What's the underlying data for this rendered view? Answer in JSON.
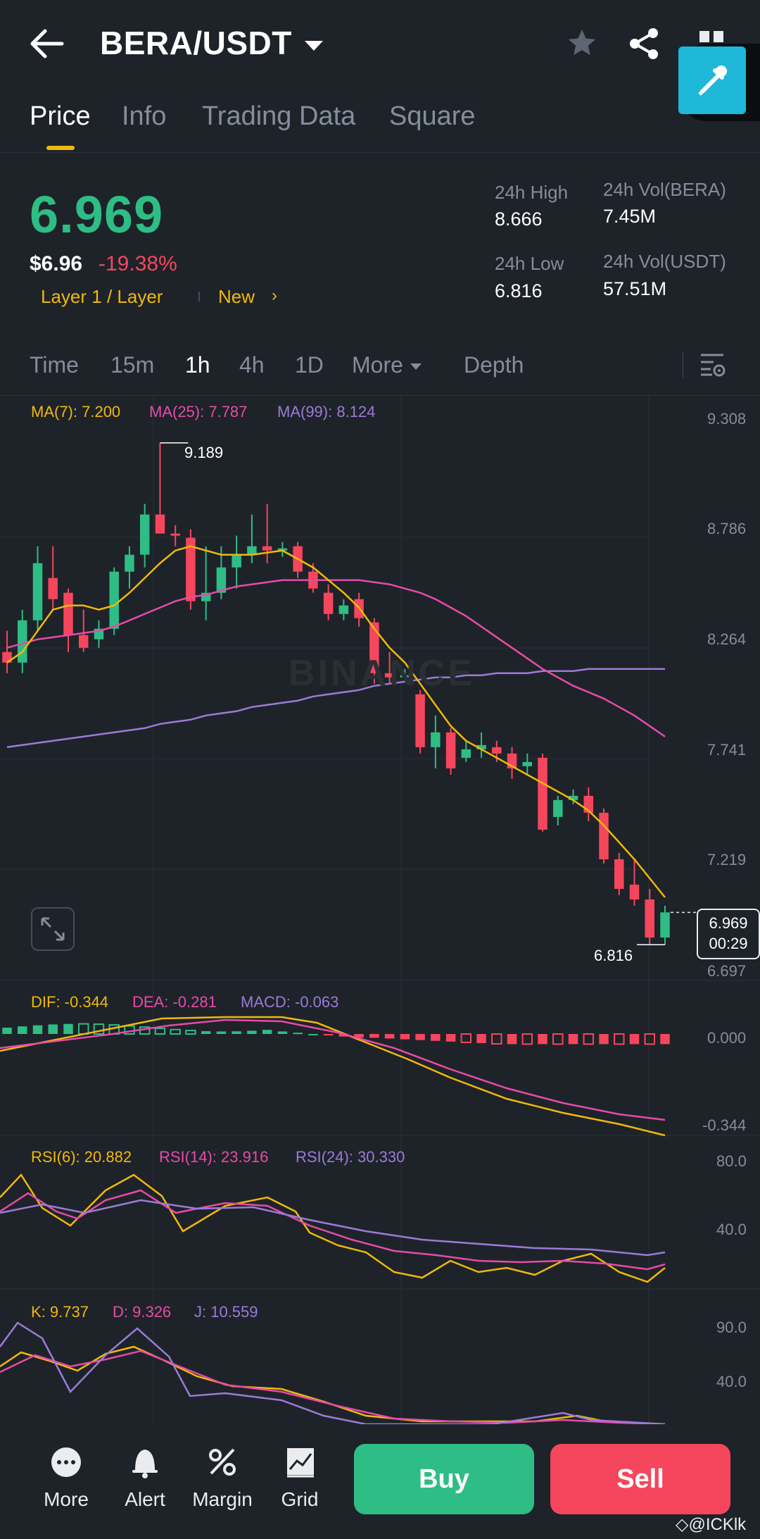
{
  "header": {
    "pair": "BERA/USDT"
  },
  "tabs": [
    "Price",
    "Info",
    "Trading Data",
    "Square"
  ],
  "price": {
    "last": "6.969",
    "usd": "$6.96",
    "change_pct": "-19.38%",
    "tag_category": "Layer 1 / Layer",
    "tag_new": "New",
    "high_label": "24h High",
    "high_value": "8.666",
    "low_label": "24h Low",
    "low_value": "6.816",
    "vol_base_label": "24h Vol(BERA)",
    "vol_base_value": "7.45M",
    "vol_quote_label": "24h Vol(USDT)",
    "vol_quote_value": "57.51M"
  },
  "timeframes": [
    "Time",
    "15m",
    "1h",
    "4h",
    "1D",
    "More",
    "Depth"
  ],
  "active_timeframe": "1h",
  "main_chart": {
    "legend": {
      "ma7": "MA(7): 7.200",
      "ma25": "MA(25): 7.787",
      "ma99": "MA(99): 8.124"
    },
    "price_ticks": [
      "9.308",
      "8.786",
      "8.264",
      "7.741",
      "7.219",
      "6.697"
    ],
    "high_marker": "9.189",
    "low_marker": "6.816",
    "current_price": "6.969",
    "countdown": "00:29",
    "watermark": "BINANCE"
  },
  "macd": {
    "dif": "DIF: -0.344",
    "dea": "DEA: -0.281",
    "macd": "MACD: -0.063",
    "ticks": [
      "0.000",
      "-0.344"
    ]
  },
  "rsi": {
    "rsi6": "RSI(6): 20.882",
    "rsi14": "RSI(14): 23.916",
    "rsi24": "RSI(24): 30.330",
    "ticks": [
      "80.0",
      "40.0"
    ]
  },
  "kdj": {
    "k": "K: 9.737",
    "d": "D: 9.326",
    "j": "J: 10.559",
    "ticks": [
      "90.0",
      "40.0"
    ]
  },
  "bottom_nav": {
    "more": "More",
    "alert": "Alert",
    "margin": "Margin",
    "grid": "Grid",
    "buy": "Buy",
    "sell": "Sell"
  },
  "watermark_user": "@ICKlk",
  "chart_data": {
    "type": "candlestick",
    "interval": "1h",
    "ylim": [
      6.697,
      9.308
    ],
    "candles": [
      [
        8.2,
        8.3,
        8.1,
        8.15
      ],
      [
        8.15,
        8.4,
        8.1,
        8.35
      ],
      [
        8.35,
        8.7,
        8.3,
        8.62
      ],
      [
        8.55,
        8.7,
        8.4,
        8.45
      ],
      [
        8.48,
        8.5,
        8.2,
        8.28
      ],
      [
        8.28,
        8.4,
        8.2,
        8.22
      ],
      [
        8.26,
        8.35,
        8.22,
        8.31
      ],
      [
        8.31,
        8.6,
        8.28,
        8.58
      ],
      [
        8.58,
        8.7,
        8.5,
        8.66
      ],
      [
        8.66,
        8.9,
        8.6,
        8.85
      ],
      [
        8.85,
        9.189,
        8.78,
        8.76
      ],
      [
        8.76,
        8.8,
        8.7,
        8.75
      ],
      [
        8.74,
        8.78,
        8.4,
        8.44
      ],
      [
        8.44,
        8.7,
        8.35,
        8.48
      ],
      [
        8.48,
        8.7,
        8.45,
        8.6
      ],
      [
        8.6,
        8.75,
        8.5,
        8.66
      ],
      [
        8.66,
        8.85,
        8.62,
        8.7
      ],
      [
        8.7,
        8.9,
        8.62,
        8.68
      ],
      [
        8.68,
        8.72,
        8.65,
        8.69
      ],
      [
        8.7,
        8.72,
        8.55,
        8.58
      ],
      [
        8.58,
        8.62,
        8.48,
        8.5
      ],
      [
        8.48,
        8.52,
        8.35,
        8.38
      ],
      [
        8.38,
        8.45,
        8.35,
        8.42
      ],
      [
        8.45,
        8.48,
        8.32,
        8.36
      ],
      [
        8.34,
        8.36,
        8.05,
        8.1
      ],
      [
        8.1,
        8.2,
        8.05,
        8.08
      ],
      [
        8.08,
        8.12,
        8.06,
        8.09
      ],
      [
        8.0,
        8.02,
        7.72,
        7.75
      ],
      [
        7.75,
        7.9,
        7.65,
        7.82
      ],
      [
        7.82,
        7.84,
        7.62,
        7.65
      ],
      [
        7.7,
        7.78,
        7.68,
        7.74
      ],
      [
        7.74,
        7.82,
        7.7,
        7.76
      ],
      [
        7.75,
        7.78,
        7.68,
        7.72
      ],
      [
        7.72,
        7.75,
        7.6,
        7.65
      ],
      [
        7.66,
        7.72,
        7.62,
        7.68
      ],
      [
        7.7,
        7.72,
        7.35,
        7.36
      ],
      [
        7.42,
        7.52,
        7.38,
        7.5
      ],
      [
        7.5,
        7.55,
        7.48,
        7.52
      ],
      [
        7.52,
        7.56,
        7.4,
        7.44
      ],
      [
        7.44,
        7.46,
        7.2,
        7.22
      ],
      [
        7.22,
        7.25,
        7.05,
        7.08
      ],
      [
        7.1,
        7.22,
        7.0,
        7.03
      ],
      [
        7.03,
        7.08,
        6.816,
        6.85
      ],
      [
        6.85,
        7.0,
        6.816,
        6.969
      ]
    ],
    "ma7": [
      8.15,
      8.2,
      8.3,
      8.4,
      8.42,
      8.42,
      8.4,
      8.42,
      8.48,
      8.55,
      8.62,
      8.68,
      8.7,
      8.68,
      8.66,
      8.66,
      8.66,
      8.67,
      8.68,
      8.64,
      8.6,
      8.54,
      8.48,
      8.41,
      8.31,
      8.22,
      8.15,
      8.05,
      7.95,
      7.85,
      7.78,
      7.74,
      7.7,
      7.66,
      7.62,
      7.58,
      7.54,
      7.5,
      7.45,
      7.38,
      7.3,
      7.22,
      7.13,
      7.04
    ],
    "ma25": [
      8.22,
      8.24,
      8.26,
      8.27,
      8.28,
      8.29,
      8.3,
      8.32,
      8.35,
      8.38,
      8.41,
      8.44,
      8.46,
      8.47,
      8.49,
      8.51,
      8.52,
      8.53,
      8.54,
      8.54,
      8.54,
      8.54,
      8.54,
      8.54,
      8.53,
      8.52,
      8.5,
      8.48,
      8.45,
      8.41,
      8.37,
      8.32,
      8.27,
      8.22,
      8.17,
      8.12,
      8.08,
      8.04,
      8.01,
      7.98,
      7.94,
      7.9,
      7.85,
      7.8
    ],
    "ma99": [
      7.75,
      7.76,
      7.77,
      7.78,
      7.79,
      7.8,
      7.81,
      7.82,
      7.83,
      7.84,
      7.86,
      7.87,
      7.88,
      7.9,
      7.91,
      7.92,
      7.94,
      7.95,
      7.96,
      7.97,
      7.99,
      8.0,
      8.01,
      8.02,
      8.04,
      8.05,
      8.06,
      8.07,
      8.08,
      8.08,
      8.09,
      8.09,
      8.1,
      8.1,
      8.1,
      8.11,
      8.11,
      8.11,
      8.12,
      8.12,
      8.12,
      8.12,
      8.12,
      8.12
    ]
  }
}
